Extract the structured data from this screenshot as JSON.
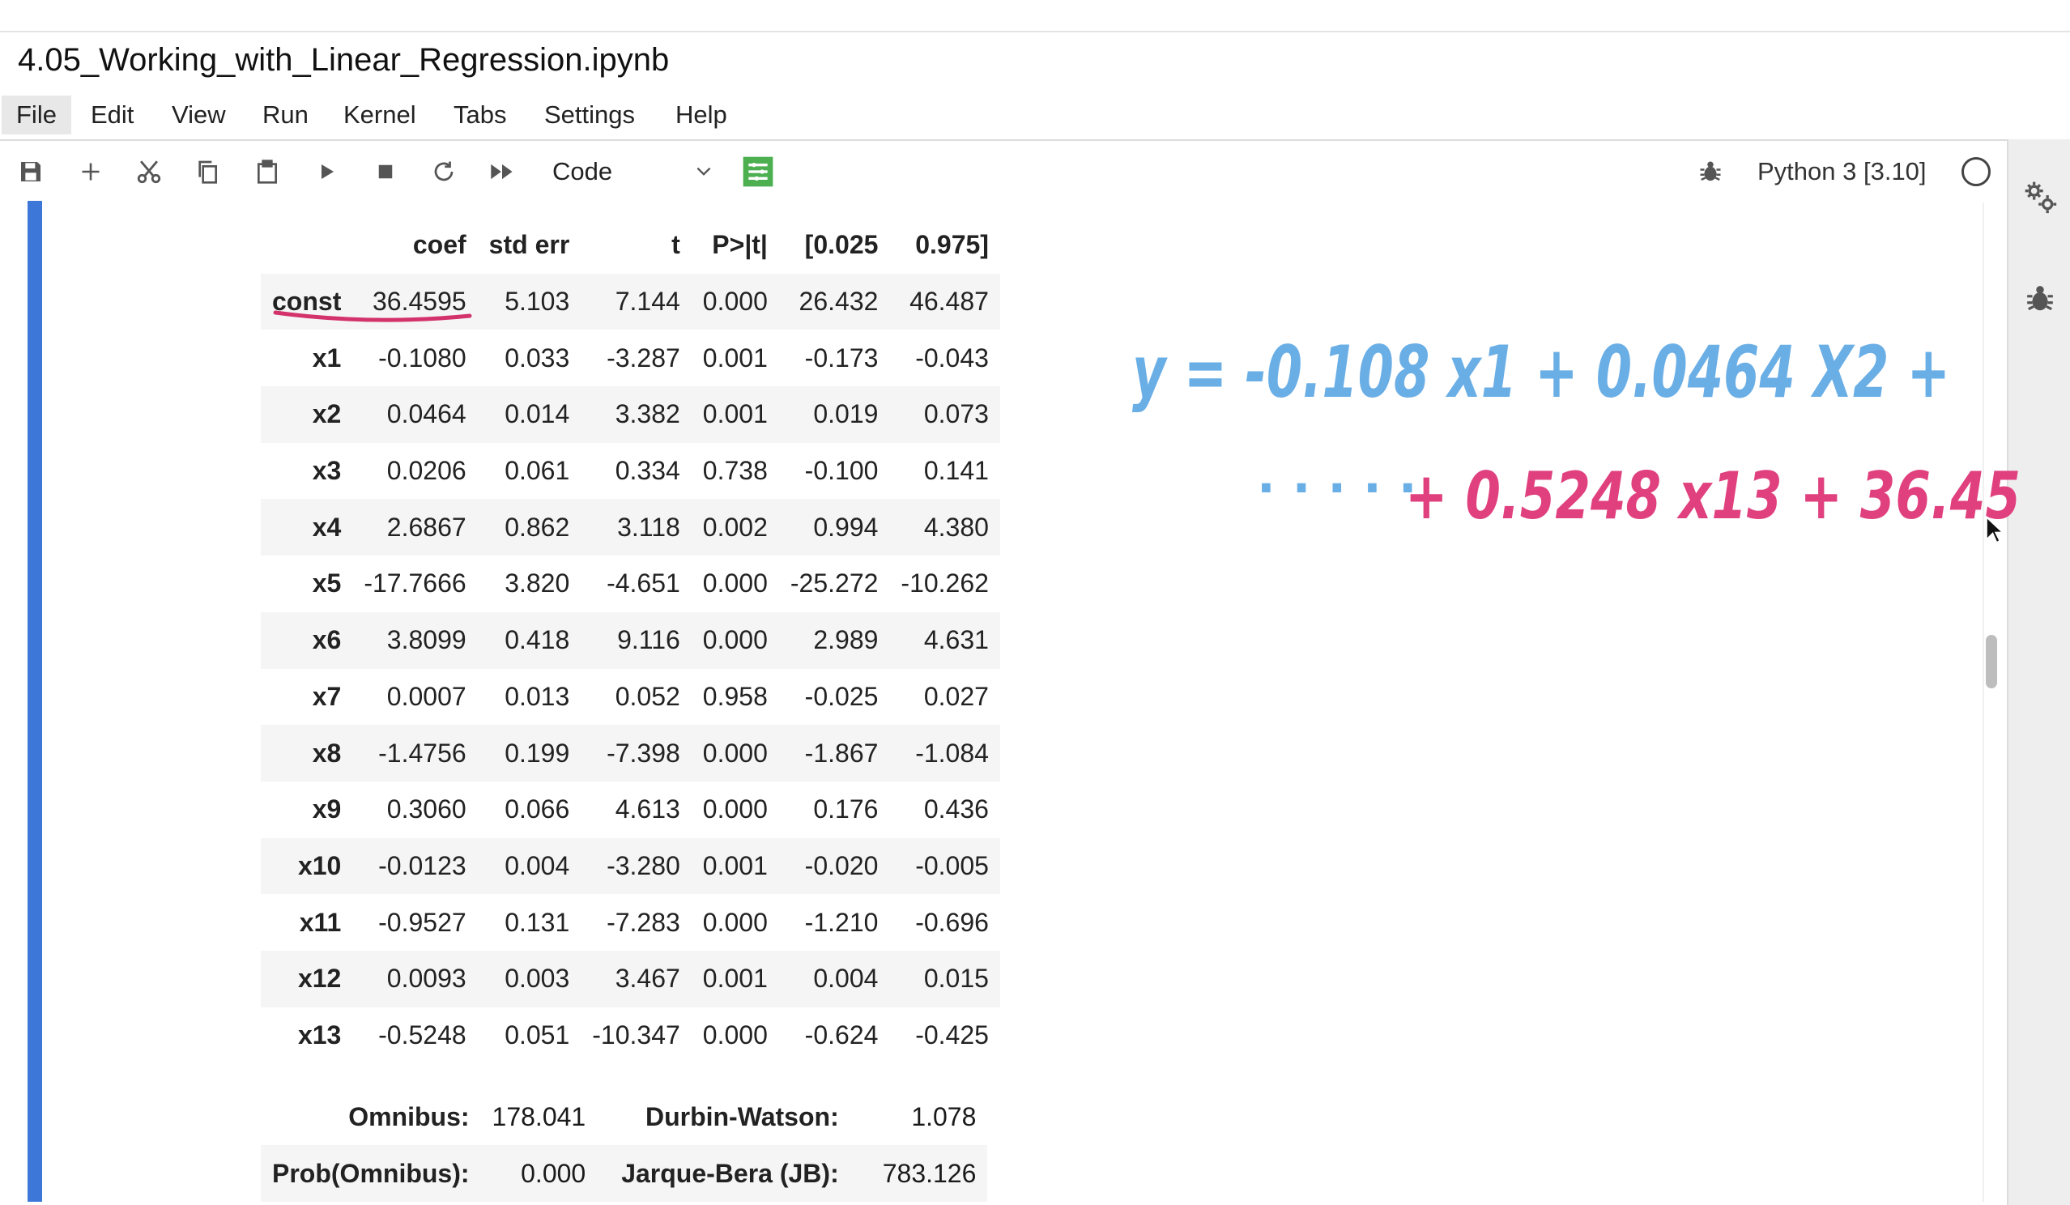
{
  "notebook": {
    "title": "4.05_Working_with_Linear_Regression.ipynb"
  },
  "menu": [
    "File",
    "Edit",
    "View",
    "Run",
    "Kernel",
    "Tabs",
    "Settings",
    "Help"
  ],
  "toolbar": {
    "cell_type": "Code",
    "kernel": "Python 3 [3.10]",
    "icons": [
      "save-icon",
      "add-icon",
      "cut-icon",
      "copy-icon",
      "paste-icon",
      "run-icon",
      "stop-icon",
      "restart-icon",
      "fast-forward-icon",
      "chevron-down-icon",
      "property-inspector-icon",
      "bug-icon",
      "kernel-status-icon"
    ]
  },
  "regression_table": {
    "columns": [
      "coef",
      "std err",
      "t",
      "P>|t|",
      "[0.025",
      "0.975]"
    ],
    "rows": [
      {
        "name": "const",
        "values": [
          "36.4595",
          "5.103",
          "7.144",
          "0.000",
          "26.432",
          "46.487"
        ]
      },
      {
        "name": "x1",
        "values": [
          "-0.1080",
          "0.033",
          "-3.287",
          "0.001",
          "-0.173",
          "-0.043"
        ]
      },
      {
        "name": "x2",
        "values": [
          "0.0464",
          "0.014",
          "3.382",
          "0.001",
          "0.019",
          "0.073"
        ]
      },
      {
        "name": "x3",
        "values": [
          "0.0206",
          "0.061",
          "0.334",
          "0.738",
          "-0.100",
          "0.141"
        ]
      },
      {
        "name": "x4",
        "values": [
          "2.6867",
          "0.862",
          "3.118",
          "0.002",
          "0.994",
          "4.380"
        ]
      },
      {
        "name": "x5",
        "values": [
          "-17.7666",
          "3.820",
          "-4.651",
          "0.000",
          "-25.272",
          "-10.262"
        ]
      },
      {
        "name": "x6",
        "values": [
          "3.8099",
          "0.418",
          "9.116",
          "0.000",
          "2.989",
          "4.631"
        ]
      },
      {
        "name": "x7",
        "values": [
          "0.0007",
          "0.013",
          "0.052",
          "0.958",
          "-0.025",
          "0.027"
        ]
      },
      {
        "name": "x8",
        "values": [
          "-1.4756",
          "0.199",
          "-7.398",
          "0.000",
          "-1.867",
          "-1.084"
        ]
      },
      {
        "name": "x9",
        "values": [
          "0.3060",
          "0.066",
          "4.613",
          "0.000",
          "0.176",
          "0.436"
        ]
      },
      {
        "name": "x10",
        "values": [
          "-0.0123",
          "0.004",
          "-3.280",
          "0.001",
          "-0.020",
          "-0.005"
        ]
      },
      {
        "name": "x11",
        "values": [
          "-0.9527",
          "0.131",
          "-7.283",
          "0.000",
          "-1.210",
          "-0.696"
        ]
      },
      {
        "name": "x12",
        "values": [
          "0.0093",
          "0.003",
          "3.467",
          "0.001",
          "0.004",
          "0.015"
        ]
      },
      {
        "name": "x13",
        "values": [
          "-0.5248",
          "0.051",
          "-10.347",
          "0.000",
          "-0.624",
          "-0.425"
        ]
      }
    ]
  },
  "stats_table": [
    {
      "label1": "Omnibus:",
      "value1": "178.041",
      "label2": "Durbin-Watson:",
      "value2": "1.078"
    },
    {
      "label1": "Prob(Omnibus):",
      "value1": "0.000",
      "label2": "Jarque-Bera (JB):",
      "value2": "783.126"
    }
  ],
  "annotation": {
    "line1": "y = -0.108 x1 + 0.0464 X2 +",
    "line2_prefix": ". . . . .",
    "line2": "+ 0.5248 x13 + 36.45",
    "colors": {
      "blue": "#6aaee6",
      "pink": "#e0407e",
      "underline": "#d3326b"
    }
  },
  "colors": {
    "cell_indicator": "#3d78d8",
    "toolbar_green": "#4caf50"
  }
}
